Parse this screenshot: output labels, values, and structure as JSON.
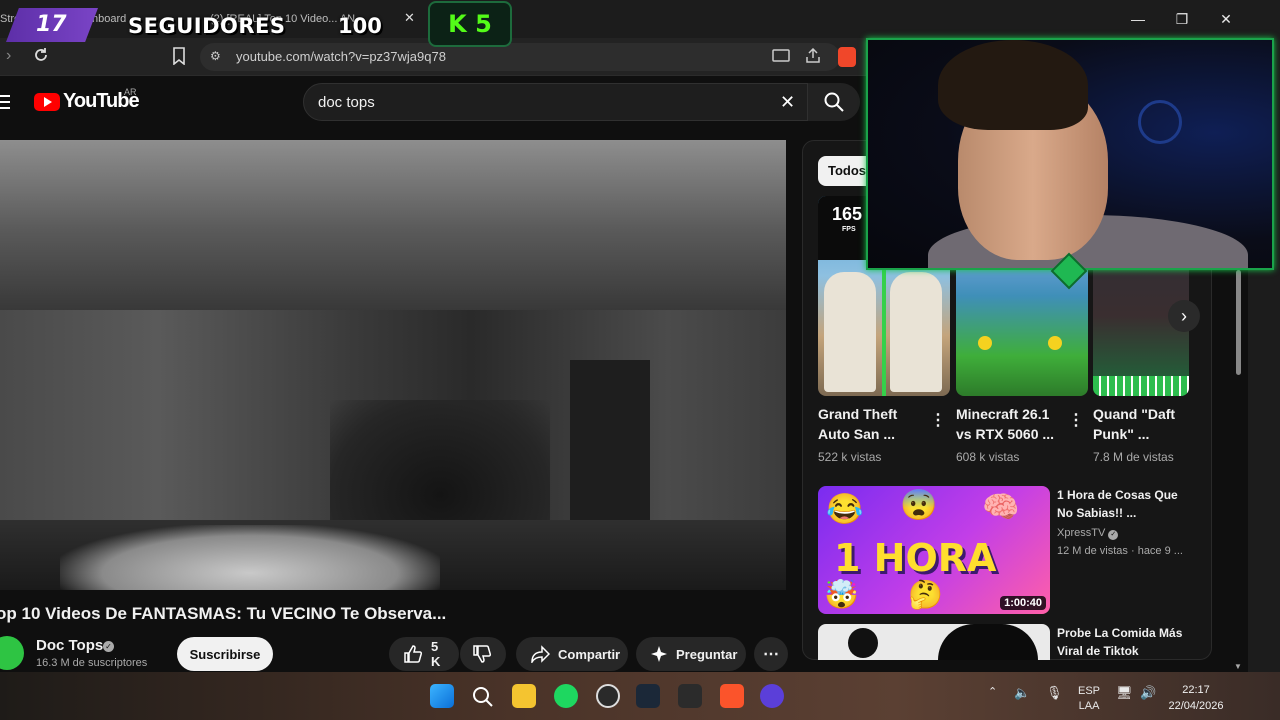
{
  "overlay": {
    "badge_number": "17",
    "label": "SEGUIDORES",
    "count": "100",
    "kick_text": "K 5"
  },
  "browser": {
    "tab1_label": "Strea",
    "tab2_label": "nboard",
    "tab3_label": "(2) [REAL] Top 10 Video... AN",
    "url": "youtube.com/watch?v=pz37wja9q78"
  },
  "yt": {
    "logo_text": "YouTube",
    "region": "AR",
    "search_value": "doc tops"
  },
  "video": {
    "title": "op 10 Videos De FANTASMAS: Tu VECINO Te Observa...",
    "channel": "Doc Tops",
    "subscribers": "16.3 M de suscriptores",
    "subscribe_label": "Suscribirse",
    "likes": "5 K",
    "share_label": "Compartir",
    "ask_label": "Preguntar"
  },
  "sidebar": {
    "chip": "Todos",
    "shorts": [
      {
        "title": "Grand Theft Auto San ...",
        "views": "522 k vistas",
        "badge": "165",
        "badge_sub": "FPS"
      },
      {
        "title": "Minecraft 26.1 vs RTX 5060 ...",
        "views": "608 k vistas"
      },
      {
        "title": "Quand \"Daft Punk\" ...",
        "views": "7.8 M de vistas"
      }
    ],
    "videos": [
      {
        "title": "1 Hora de Cosas Que No Sabias!! ...",
        "channel": "XpressTV",
        "meta": "12 M de vistas · hace 9 ...",
        "thumb_text": "1 HORA",
        "duration": "1:00:40"
      },
      {
        "title": "Probe La Comida Más Viral de Tiktok",
        "channel": "",
        "meta": ""
      }
    ]
  },
  "taskbar": {
    "lang_top": "ESP",
    "lang_bottom": "LAA",
    "time": "22:17",
    "date": "22/04/2026"
  }
}
